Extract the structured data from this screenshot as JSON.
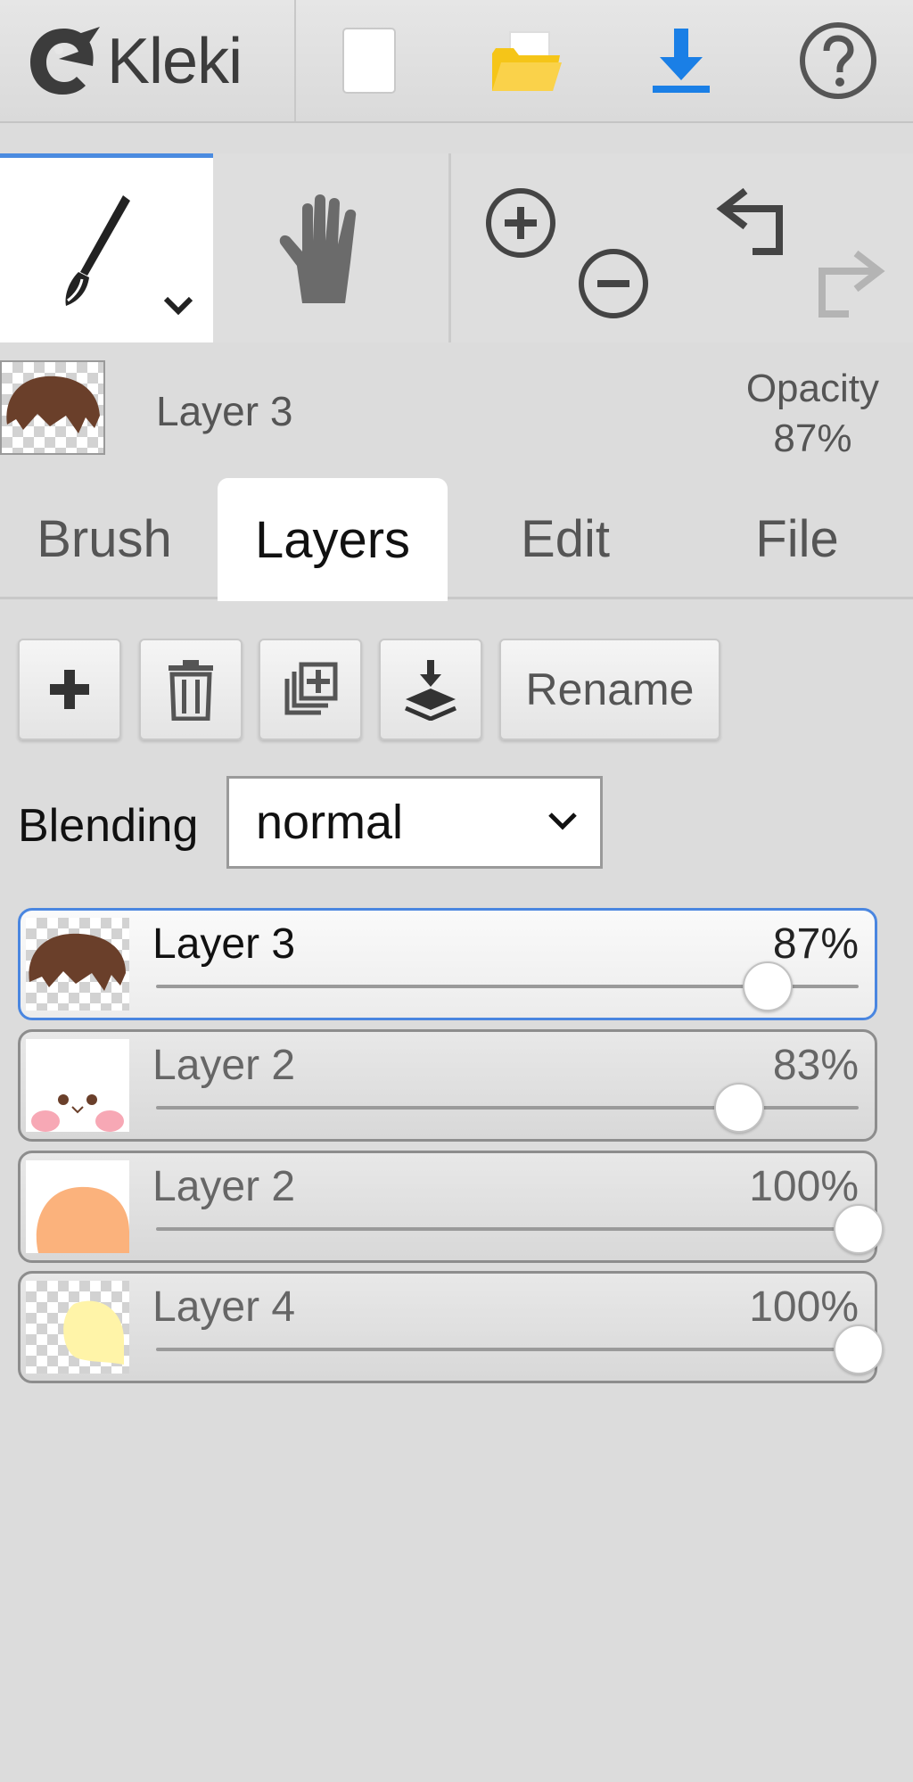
{
  "app": {
    "logo_text": "Kleki"
  },
  "toolbar": {
    "icons": [
      "new-image-icon",
      "open-folder-icon",
      "download-icon",
      "help-icon"
    ],
    "tools": [
      "brush-tool-icon",
      "hand-tool-icon",
      "zoom-in-icon",
      "zoom-out-icon",
      "undo-icon",
      "redo-icon"
    ],
    "accent": "#1a7fe6"
  },
  "current_layer": {
    "name": "Layer 3",
    "opacity_label": "Opacity",
    "opacity_value": "87%"
  },
  "tabs": [
    {
      "label": "Brush",
      "active": false
    },
    {
      "label": "Layers",
      "active": true
    },
    {
      "label": "Edit",
      "active": false
    },
    {
      "label": "File",
      "active": false
    }
  ],
  "layer_actions": {
    "rename_label": "Rename",
    "icons": [
      "add-layer-icon",
      "delete-layer-icon",
      "duplicate-layer-icon",
      "merge-down-icon"
    ]
  },
  "blending": {
    "label": "Blending",
    "value": "normal"
  },
  "layers": [
    {
      "name": "Layer 3",
      "percent": "87%",
      "opacity": 0.87,
      "selected": true
    },
    {
      "name": "Layer 2",
      "percent": "83%",
      "opacity": 0.83,
      "selected": false
    },
    {
      "name": "Layer 2",
      "percent": "100%",
      "opacity": 1.0,
      "selected": false
    },
    {
      "name": "Layer 4",
      "percent": "100%",
      "opacity": 1.0,
      "selected": false
    }
  ]
}
